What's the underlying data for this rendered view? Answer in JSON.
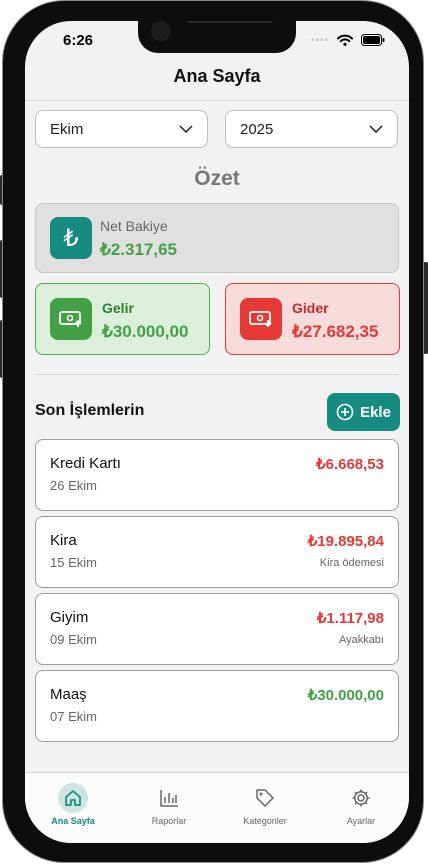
{
  "status_bar": {
    "time": "6:26"
  },
  "header": {
    "title": "Ana Sayfa"
  },
  "filters": {
    "month": "Ekim",
    "year": "2025"
  },
  "summary": {
    "title": "Özet",
    "net": {
      "label": "Net Bakiye",
      "value": "₺2.317,65",
      "icon": "lira-icon"
    },
    "income": {
      "label": "Gelir",
      "value": "₺30.000,00",
      "icon": "money-in-icon"
    },
    "expense": {
      "label": "Gider",
      "value": "₺27.682,35",
      "icon": "money-out-icon"
    }
  },
  "transactions_section": {
    "title": "Son İşlemlerin",
    "add_label": "Ekle"
  },
  "transactions": [
    {
      "title": "Kredi Kartı",
      "date": "26 Ekim",
      "amount": "₺6.668,53",
      "note": "",
      "type": "expense"
    },
    {
      "title": "Kira",
      "date": "15 Ekim",
      "amount": "₺19.895,84",
      "note": "Kira ödemesi",
      "type": "expense"
    },
    {
      "title": "Giyim",
      "date": "09 Ekim",
      "amount": "₺1.117,98",
      "note": "Ayakkabı",
      "type": "expense"
    },
    {
      "title": "Maaş",
      "date": "07 Ekim",
      "amount": "₺30.000,00",
      "note": "",
      "type": "income"
    }
  ],
  "tabs": [
    {
      "label": "Ana Sayfa",
      "icon": "home-icon",
      "active": true
    },
    {
      "label": "Raporlar",
      "icon": "bar-chart-icon",
      "active": false
    },
    {
      "label": "Kategoriler",
      "icon": "tag-icon",
      "active": false
    },
    {
      "label": "Ayarlar",
      "icon": "gear-icon",
      "active": false
    }
  ],
  "colors": {
    "accent": "#168c80",
    "income": "#43a047",
    "expense": "#e53935"
  }
}
